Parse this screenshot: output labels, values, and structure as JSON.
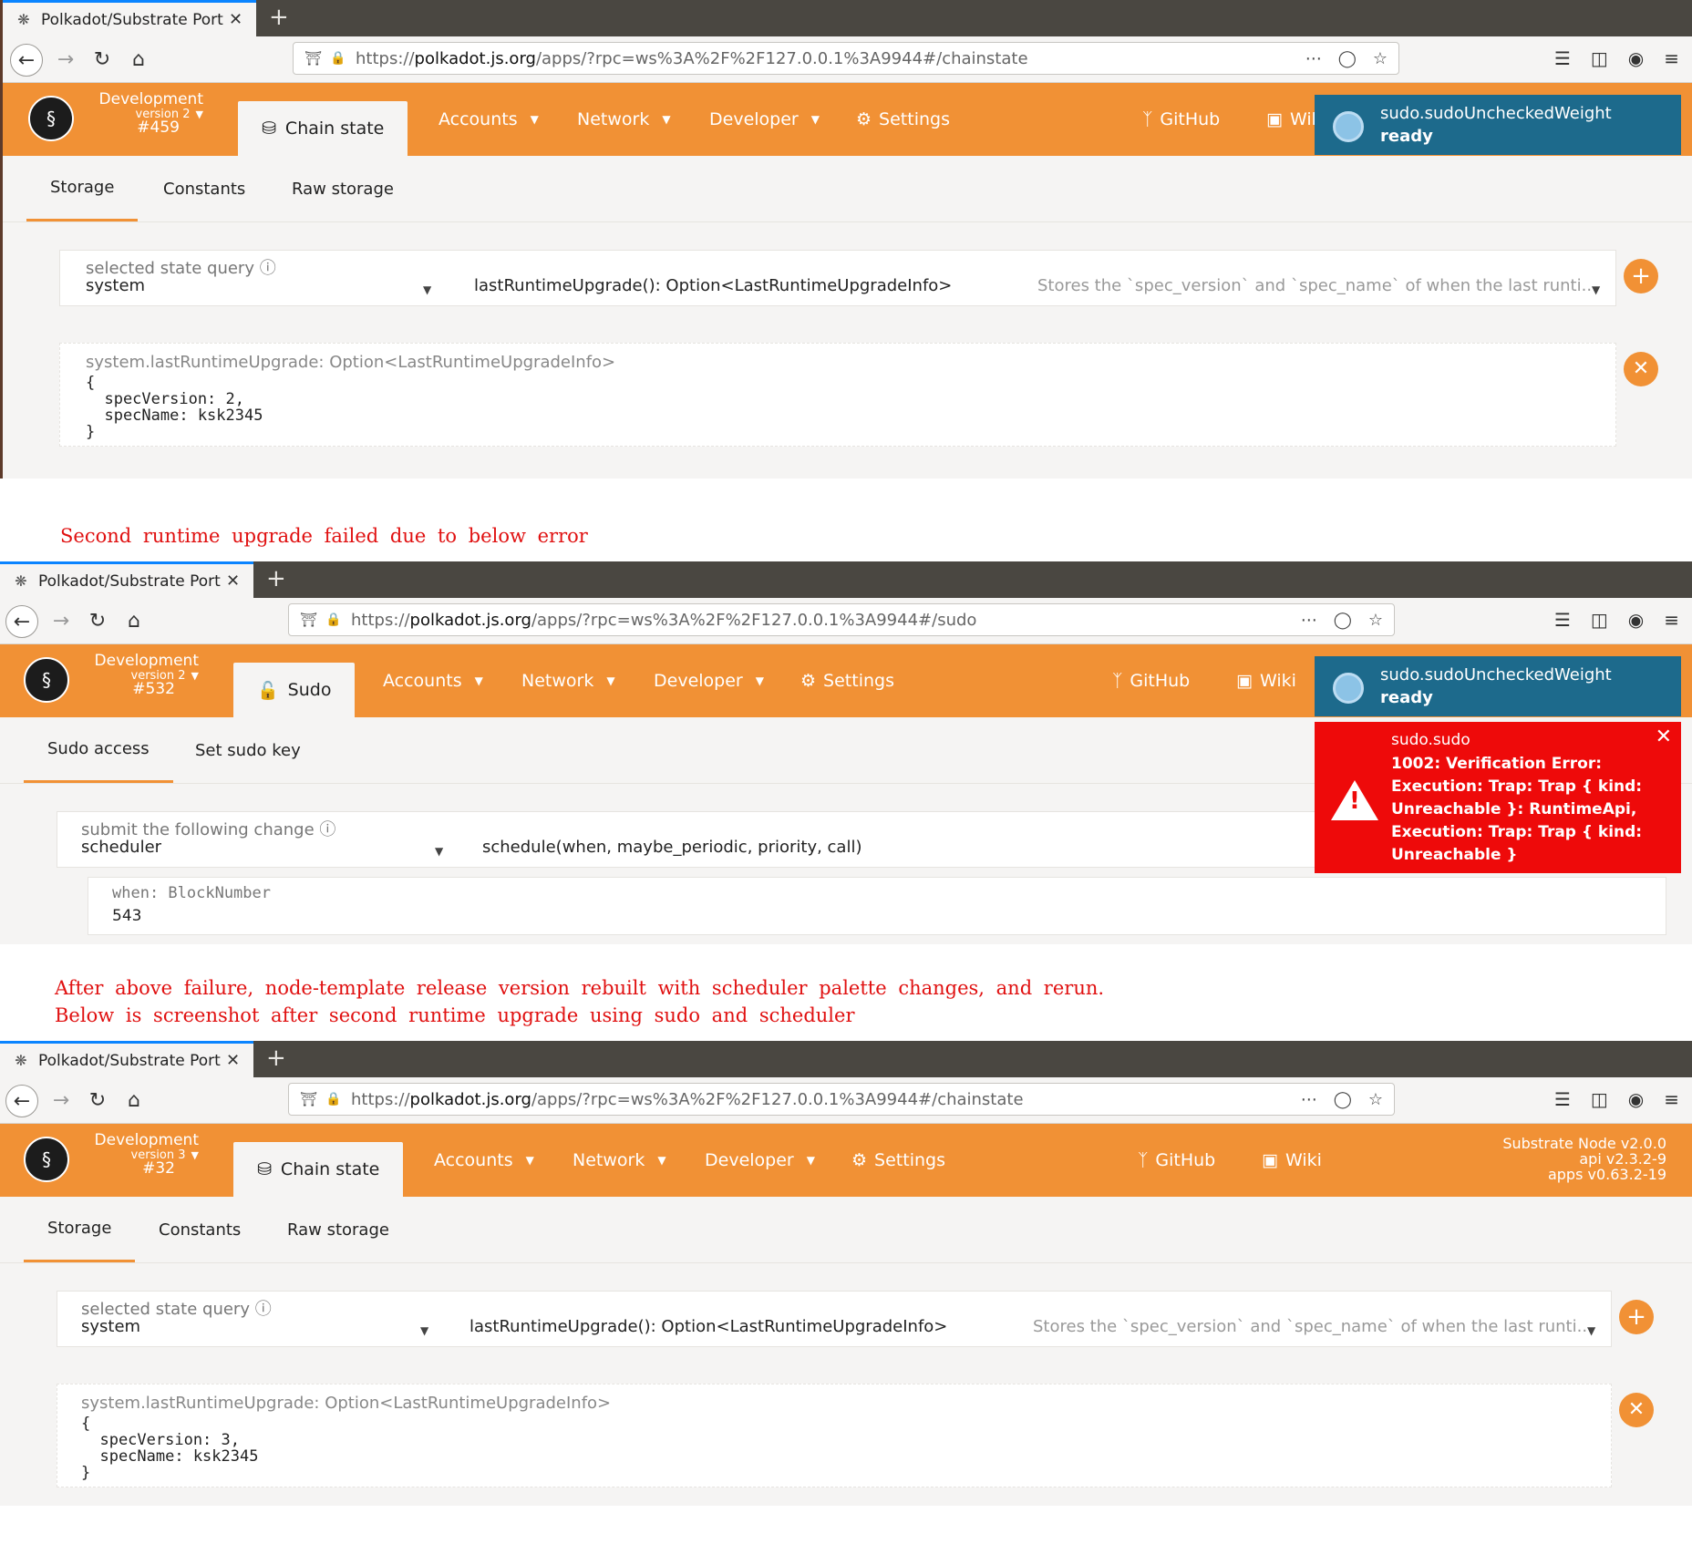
{
  "browser": {
    "tab_title": "Polkadot/Substrate Port",
    "url_prefix": "https://",
    "url_host": "polkadot.js.org",
    "url_path_chainstate": "/apps/?rpc=ws%3A%2F%2F127.0.0.1%3A9944#/chainstate",
    "url_path_sudo": "/apps/?rpc=ws%3A%2F%2F127.0.0.1%3A9944#/sudo"
  },
  "nav": {
    "accounts": "Accounts",
    "network": "Network",
    "developer": "Developer",
    "settings": "Settings",
    "github": "GitHub",
    "wiki": "Wiki",
    "wiki_clipped": "Wik"
  },
  "shot1": {
    "chain_name": "Development",
    "version": "version 2",
    "block": "#459",
    "active_tab": "Chain state",
    "subtabs": [
      "Storage",
      "Constants",
      "Raw storage"
    ],
    "query_label": "selected state query",
    "query_module": "system",
    "query_method": "lastRuntimeUpgrade(): Option<LastRuntimeUpgradeInfo>",
    "query_desc": "Stores the `spec_version` and `spec_name` of when the last runti...",
    "result_title": "system.lastRuntimeUpgrade: Option<LastRuntimeUpgradeInfo>",
    "result_body": "{\n  specVersion: 2,\n  specName: ksk2345\n}",
    "toast_title": "sudo.sudoUncheckedWeight",
    "toast_status": "ready"
  },
  "note1": "Second runtime upgrade failed due to below error",
  "shot2": {
    "chain_name": "Development",
    "version": "version 2",
    "block": "#532",
    "active_tab": "Sudo",
    "subtabs": [
      "Sudo access",
      "Set sudo key"
    ],
    "change_label": "submit the following change",
    "module": "scheduler",
    "method": "schedule(when, maybe_periodic, priority, call)",
    "param_label": "when: BlockNumber",
    "param_value": "543",
    "toast_title": "sudo.sudoUncheckedWeight",
    "toast_status": "ready",
    "error_title": "sudo.sudo",
    "error_message": "1002: Verification Error: Execution: Trap: Trap { kind: Unreachable }: RuntimeApi, Execution: Trap: Trap { kind: Unreachable }"
  },
  "note2_line1": "After above failure, node-template release version rebuilt with scheduler palette changes, and rerun.",
  "note2_line2": "Below is screenshot after second runtime upgrade using sudo and scheduler",
  "shot3": {
    "chain_name": "Development",
    "version": "version 3",
    "block": "#32",
    "active_tab": "Chain state",
    "subtabs": [
      "Storage",
      "Constants",
      "Raw storage"
    ],
    "node_version": "Substrate Node v2.0.0",
    "api_version": "api v2.3.2-9",
    "apps_version": "apps v0.63.2-19",
    "query_label": "selected state query",
    "query_module": "system",
    "query_method": "lastRuntimeUpgrade(): Option<LastRuntimeUpgradeInfo>",
    "query_desc": "Stores the `spec_version` and `spec_name` of when the last runti...",
    "result_title": "system.lastRuntimeUpgrade: Option<LastRuntimeUpgradeInfo>",
    "result_body": "{\n  specVersion: 3,\n  specName: ksk2345\n}"
  },
  "colors": {
    "accent": "#f19135",
    "toast": "#1d6a8c",
    "error": "#ee0a0a",
    "note_text": "#e01010"
  }
}
